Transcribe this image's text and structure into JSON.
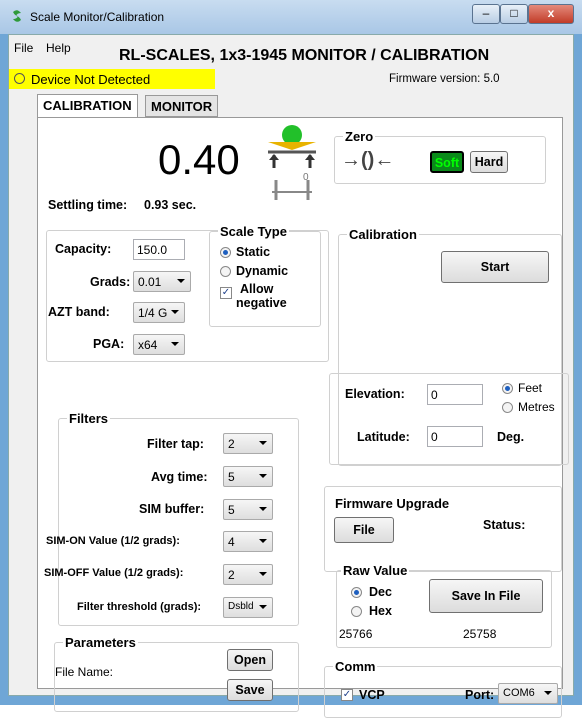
{
  "window": {
    "title": "Scale Monitor/Calibration",
    "min": "–",
    "max": "□",
    "close": "x"
  },
  "menu": {
    "file": "File",
    "help": "Help"
  },
  "app_title": "RL-SCALES, 1x3-1945 MONITOR / CALIBRATION",
  "device_status": "Device Not Detected",
  "firmware_version": "Firmware version: 5.0",
  "tabs": {
    "calibration": "CALIBRATION",
    "monitor": "MONITOR"
  },
  "reading": {
    "value": "0.40",
    "settling_label": "Settling time:",
    "settling_value": "0.93 sec.",
    "zero_glyph": "0"
  },
  "zero": {
    "title": "Zero",
    "soft": "Soft",
    "hard": "Hard",
    "arrow_glyph": "→()←"
  },
  "settings": {
    "capacity_label": "Capacity:",
    "capacity_value": "150.0",
    "grads_label": "Grads:",
    "grads_value": "0.01",
    "azt_label": "AZT band:",
    "azt_value": "1/4 G",
    "pga_label": "PGA:",
    "pga_value": "x64"
  },
  "scale_type": {
    "title": "Scale Type",
    "static": "Static",
    "dynamic": "Dynamic",
    "allow": "Allow",
    "negative": "negative"
  },
  "calibration": {
    "title": "Calibration",
    "start": "Start",
    "elevation_label": "Elevation:",
    "elevation_value": "0",
    "feet": "Feet",
    "metres": "Metres",
    "latitude_label": "Latitude:",
    "latitude_value": "0",
    "deg": "Deg."
  },
  "filters": {
    "title": "Filters",
    "filter_tap_label": "Filter tap:",
    "filter_tap_value": "2",
    "avg_time_label": "Avg time:",
    "avg_time_value": "5",
    "sim_buffer_label": "SIM buffer:",
    "sim_buffer_value": "5",
    "sim_on_label": "SIM-ON Value (1/2 grads):",
    "sim_on_value": "4",
    "sim_off_label": "SIM-OFF Value (1/2 grads):",
    "sim_off_value": "2",
    "threshold_label": "Filter threshold (grads):",
    "threshold_value": "Dsbld"
  },
  "firmware_upgrade": {
    "title": "Firmware Upgrade",
    "file": "File",
    "status": "Status:"
  },
  "raw_value": {
    "title": "Raw Value",
    "dec": "Dec",
    "hex": "Hex",
    "save": "Save In File",
    "value1": "25766",
    "value2": "25758"
  },
  "parameters": {
    "title": "Parameters",
    "file_name": "File Name:",
    "open": "Open",
    "save": "Save"
  },
  "comm": {
    "title": "Comm",
    "vcp": "VCP",
    "port_label": "Port:",
    "port_value": "COM6"
  },
  "colors": {
    "title_bar": "#b9d1ea",
    "status_bg": "#ffff00",
    "soft_btn": "#0a8a1a",
    "ind_green": "#22c02a",
    "ind_gold": "#e8b300"
  }
}
